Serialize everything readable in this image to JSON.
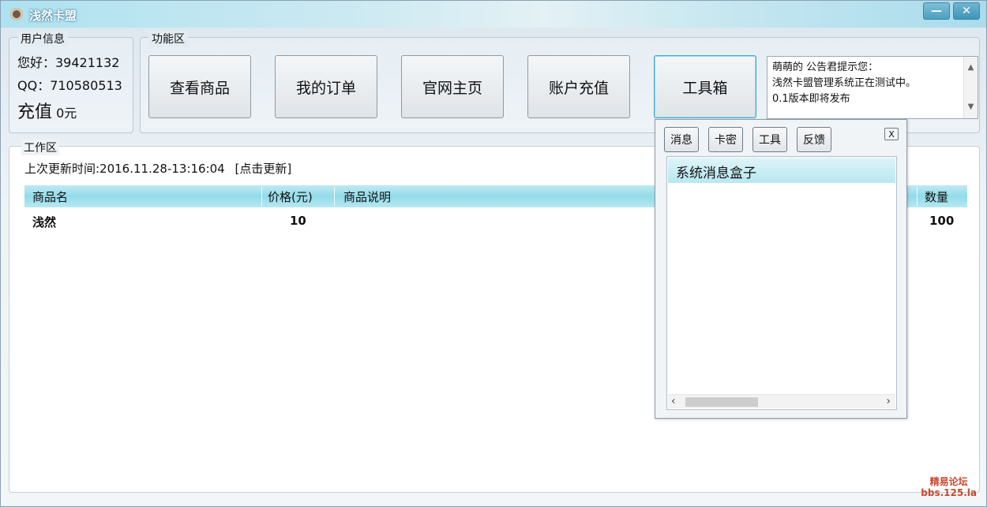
{
  "window": {
    "title": "浅然卡盟",
    "minimize_glyph": "—",
    "close_glyph": "✕"
  },
  "user_info": {
    "legend": "用户信息",
    "greeting": "您好：39421132",
    "qq": "QQ：710580513",
    "recharge_label": "充值",
    "recharge_value": "0元"
  },
  "function_area": {
    "legend": "功能区",
    "buttons": [
      "查看商品",
      "我的订单",
      "官网主页",
      "账户充值",
      "工具箱"
    ]
  },
  "notice": {
    "lines": [
      "萌萌的 公告君提示您：",
      "浅然卡盟管理系统正在测试中。",
      "0.1版本即将发布"
    ]
  },
  "work_area": {
    "legend": "工作区",
    "update_text": "上次更新时间:2016.11.28-13:16:04",
    "update_link": "[点击更新]",
    "columns": [
      "商品名",
      "价格(元)",
      "商品说明",
      "数量"
    ],
    "rows": [
      {
        "name": "浅然",
        "price": "10",
        "desc": "",
        "qty": "100"
      }
    ]
  },
  "toolbox": {
    "tabs": [
      "消息",
      "卡密",
      "工具",
      "反馈"
    ],
    "close_label": "X",
    "list_items": [
      "系统消息盒子"
    ]
  },
  "watermark": {
    "line1": "精易论坛",
    "line2": "bbs.125.la"
  }
}
